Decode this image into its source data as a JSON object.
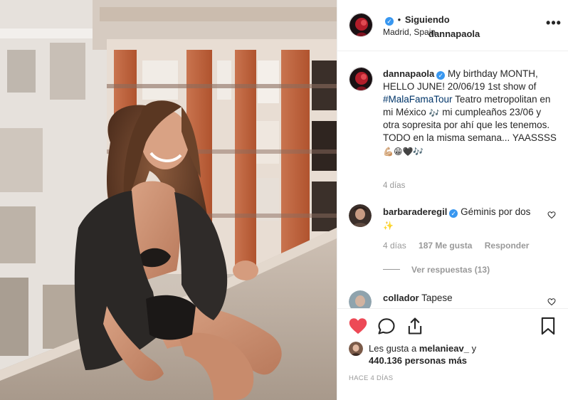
{
  "post": {
    "username": "dannapaola",
    "follow_status": "Siguiendo",
    "separator": "•",
    "location": "Madrid, Spain",
    "more_icon": "more-options-icon"
  },
  "caption": {
    "username": "dannapaola",
    "text_1": "My birthday MONTH, HELLO JUNE! 20/06/19 1st show of",
    "hashtag": "#MalaFamaTour",
    "text_2": "Teatro metropolitan en mi México",
    "emoji_1": "🎶",
    "text_3": "mi cumpleaños 23/06 y otra sopresita por ahí que les tenemos.",
    "text_4": "TODO en la misma semana... YAASSSS",
    "emojis": [
      "💪🏼",
      "😁",
      "🖤",
      "🎶"
    ],
    "time": "4 días"
  },
  "comments": [
    {
      "username": "barbaraderegil",
      "verified": true,
      "text": "Géminis por dos",
      "emoji": "✨",
      "time": "4 días",
      "likes": "187 Me gusta",
      "reply_label": "Responder",
      "view_replies": "Ver respuestas (13)"
    },
    {
      "username": "collador",
      "verified": false,
      "text": "Tapese"
    }
  ],
  "actions": {
    "like_icon": "heart-filled-icon",
    "comment_icon": "comment-icon",
    "share_icon": "share-icon",
    "save_icon": "bookmark-icon",
    "like_color": "#ed4956"
  },
  "likes": {
    "prefix": "Les gusta a",
    "user": "melanieav_",
    "conjunction": "y",
    "others": "440.136 personas más"
  },
  "posted_ago": "HACE 4 DÍAS"
}
